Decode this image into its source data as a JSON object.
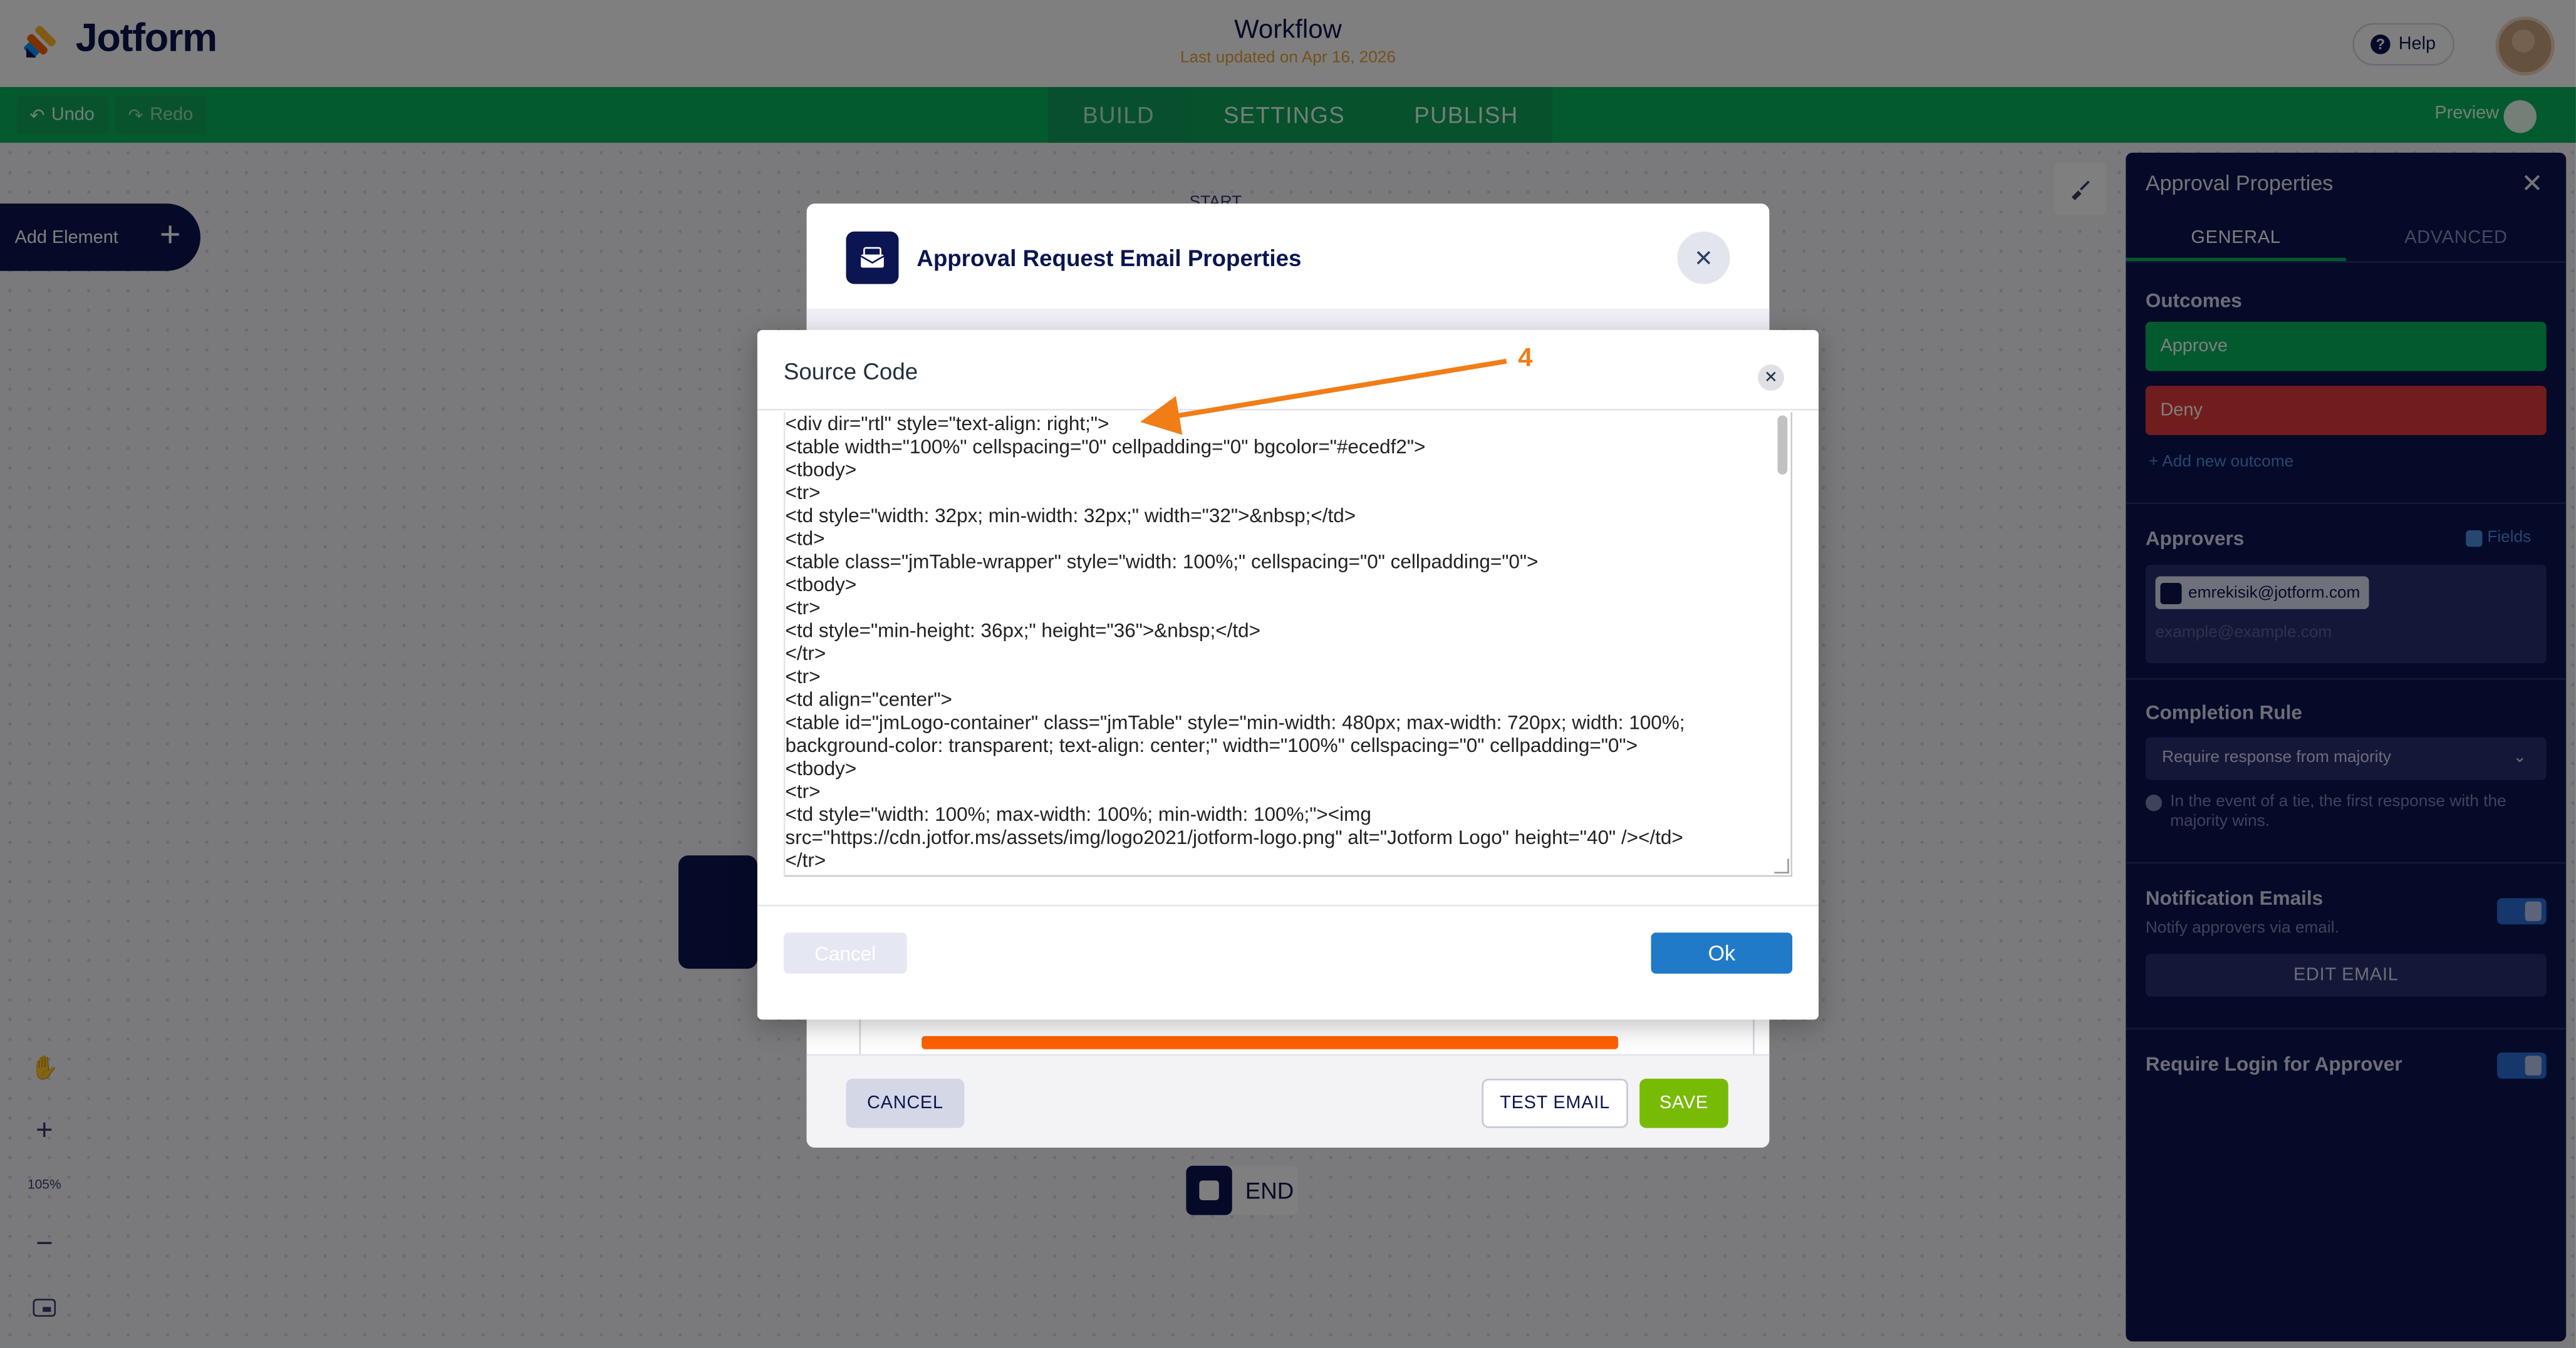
{
  "app": {
    "brand": "Jotform",
    "workflow_title": "Workflow",
    "last_updated": "Last updated on Apr 16, 2026",
    "help_label": "Help"
  },
  "toolbar": {
    "undo_label": "Undo",
    "redo_label": "Redo",
    "tabs": [
      {
        "label": "BUILD",
        "active": true
      },
      {
        "label": "SETTINGS",
        "active": false
      },
      {
        "label": "PUBLISH",
        "active": false
      }
    ],
    "preview_label": "Preview"
  },
  "canvas": {
    "add_element_label": "Add Element",
    "start_label": "START",
    "end_label": "END",
    "zoom_level": "105%"
  },
  "right_panel": {
    "title": "Approval Properties",
    "tabs": [
      {
        "label": "GENERAL",
        "active": true
      },
      {
        "label": "ADVANCED",
        "active": false
      }
    ],
    "outcomes_label": "Outcomes",
    "outcomes": [
      {
        "label": "Approve",
        "color": "#09b45f"
      },
      {
        "label": "Deny",
        "color": "#e53b3b"
      }
    ],
    "add_outcome_label": "+ Add new outcome",
    "approvers_label": "Approvers",
    "fields_label": "Fields",
    "approver_email": "emrekisik@jotform.com",
    "approver_placeholder": "example@example.com",
    "completion_rule_label": "Completion Rule",
    "completion_rule_value": "Require response from majority",
    "completion_hint": "In the event of a tie, the first response with the majority wins.",
    "notification_label": "Notification Emails",
    "notification_sub": "Notify approvers via email.",
    "edit_email_label": "EDIT EMAIL",
    "require_login_label": "Require Login for Approver"
  },
  "email_dialog": {
    "title": "Approval Request Email Properties",
    "cancel_label": "CANCEL",
    "test_email_label": "TEST EMAIL",
    "save_label": "SAVE"
  },
  "source_dialog": {
    "title": "Source Code",
    "code_lines": [
      "<div dir=\"rtl\" style=\"text-align: right;\">",
      "<table width=\"100%\" cellspacing=\"0\" cellpadding=\"0\" bgcolor=\"#ecedf2\">",
      "<tbody>",
      "<tr>",
      "<td style=\"width: 32px; min-width: 32px;\" width=\"32\">&nbsp;</td>",
      "<td>",
      "<table class=\"jmTable-wrapper\" style=\"width: 100%;\" cellspacing=\"0\" cellpadding=\"0\">",
      "<tbody>",
      "<tr>",
      "<td style=\"min-height: 36px;\" height=\"36\">&nbsp;</td>",
      "</tr>",
      "<tr>",
      "<td align=\"center\">",
      "<table id=\"jmLogo-container\" class=\"jmTable\" style=\"min-width: 480px; max-width: 720px; width: 100%; background-color: transparent; text-align: center;\" width=\"100%\" cellspacing=\"0\" cellpadding=\"0\">",
      "<tbody>",
      "<tr>",
      "<td style=\"width: 100%; max-width: 100%; min-width: 100%;\"><img src=\"https://cdn.jotfor.ms/assets/img/logo2021/jotform-logo.png\" alt=\"Jotform Logo\" height=\"40\" /></td>",
      "</tr>"
    ],
    "cancel_label": "Cancel",
    "ok_label": "Ok"
  },
  "annotation": {
    "number": "4",
    "color": "#f07d18"
  }
}
